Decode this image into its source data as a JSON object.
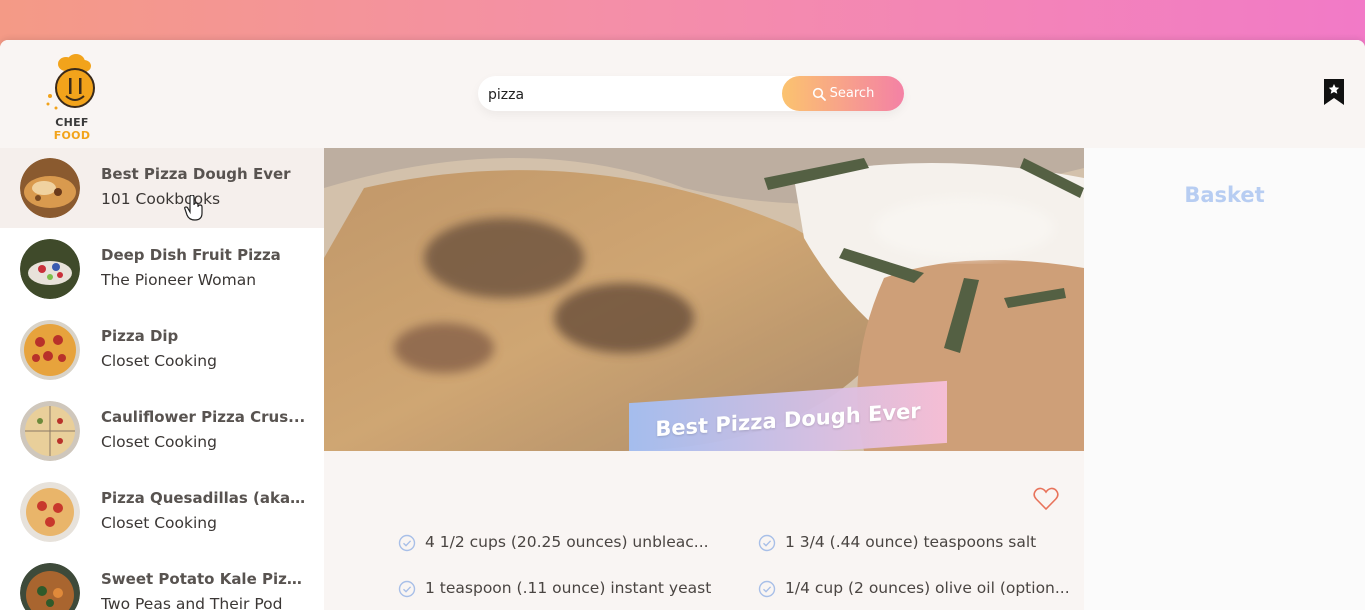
{
  "header": {
    "logo": {
      "word1": "CHEF",
      "word2": "FOOD"
    },
    "search": {
      "value": "pizza",
      "button_label": "Search"
    },
    "bookmark_icon": "bookmark-icon"
  },
  "results": [
    {
      "title": "Best Pizza Dough Ever",
      "publisher": "101 Cookbooks",
      "active": true
    },
    {
      "title": "Deep Dish Fruit Pizza",
      "publisher": "The Pioneer Woman",
      "active": false
    },
    {
      "title": "Pizza Dip",
      "publisher": "Closet Cooking",
      "active": false
    },
    {
      "title": "Cauliflower Pizza Crus...",
      "publisher": "Closet Cooking",
      "active": false
    },
    {
      "title": "Pizza Quesadillas (aka...",
      "publisher": "Closet Cooking",
      "active": false
    },
    {
      "title": "Sweet Potato Kale Pizz...",
      "publisher": "Two Peas and Their Pod",
      "active": false
    }
  ],
  "recipe": {
    "title": "Best Pizza Dough Ever",
    "ingredients": [
      "4 1/2 cups (20.25 ounces) unbleac...",
      "1 3/4 (.44 ounce) teaspoons salt",
      "1 teaspoon (.11 ounce) instant yeast",
      "1/4 cup (2 ounces) olive oil (option..."
    ]
  },
  "basket": {
    "title": "Basket"
  },
  "colors": {
    "accent_orange": "#fbc36f",
    "accent_pink": "#f481a5",
    "basket_title": "#b7cdf2",
    "heart": "#e8735b"
  }
}
